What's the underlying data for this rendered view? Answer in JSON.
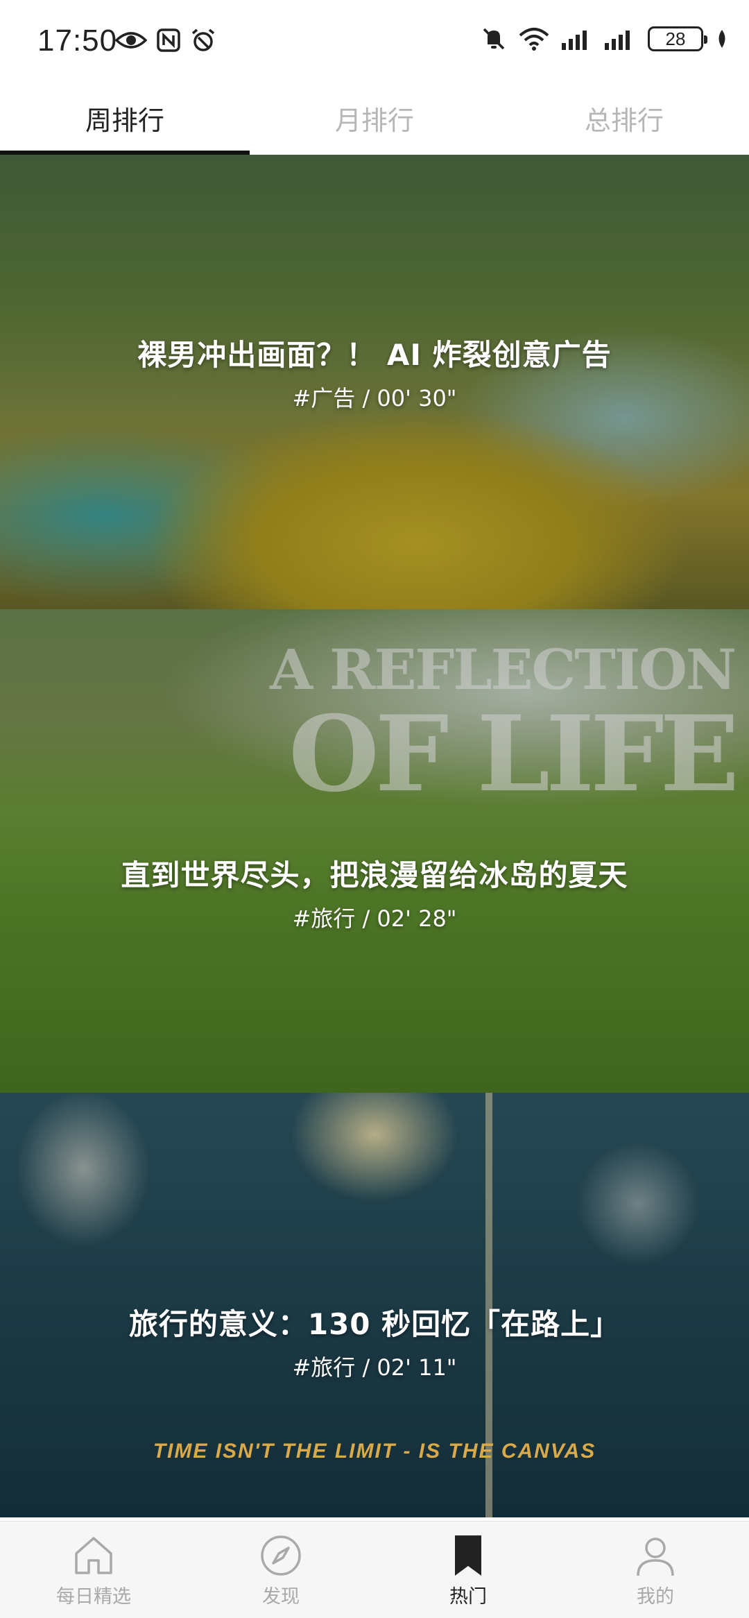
{
  "status_bar": {
    "time": "17:50",
    "left_icons": [
      "eye-icon",
      "nfc-icon",
      "alarm-icon"
    ],
    "right_icons": [
      "mute-icon",
      "wifi-icon",
      "signal-icon",
      "signal-icon-2"
    ],
    "battery": "28"
  },
  "tabs": [
    {
      "label": "周排行",
      "active": true
    },
    {
      "label": "月排行",
      "active": false
    },
    {
      "label": "总排行",
      "active": false
    }
  ],
  "videos": [
    {
      "title": "裸男冲出画面？！ AI 炸裂创意广告",
      "meta": "#广告 / 00' 30\""
    },
    {
      "title": "直到世界尽头，把浪漫留给冰岛的夏天",
      "meta": "#旅行 / 02' 28\"",
      "art_text_1": "A REFLECTION",
      "art_text_2": "OF LIFE"
    },
    {
      "title": "旅行的意义：130 秒回忆「在路上」",
      "meta": "#旅行 / 02' 11\"",
      "art_caption": "TIME ISN'T THE LIMIT - IS THE CANVAS"
    }
  ],
  "bottom_nav": [
    {
      "label": "每日精选",
      "icon": "home-icon",
      "active": false
    },
    {
      "label": "发现",
      "icon": "compass-icon",
      "active": false
    },
    {
      "label": "热门",
      "icon": "bookmark-icon",
      "active": true
    },
    {
      "label": "我的",
      "icon": "user-icon",
      "active": false
    }
  ],
  "colors": {
    "active_text": "#222222",
    "inactive_text": "#b6b6b6",
    "caption_gold": "#d9a94a"
  }
}
